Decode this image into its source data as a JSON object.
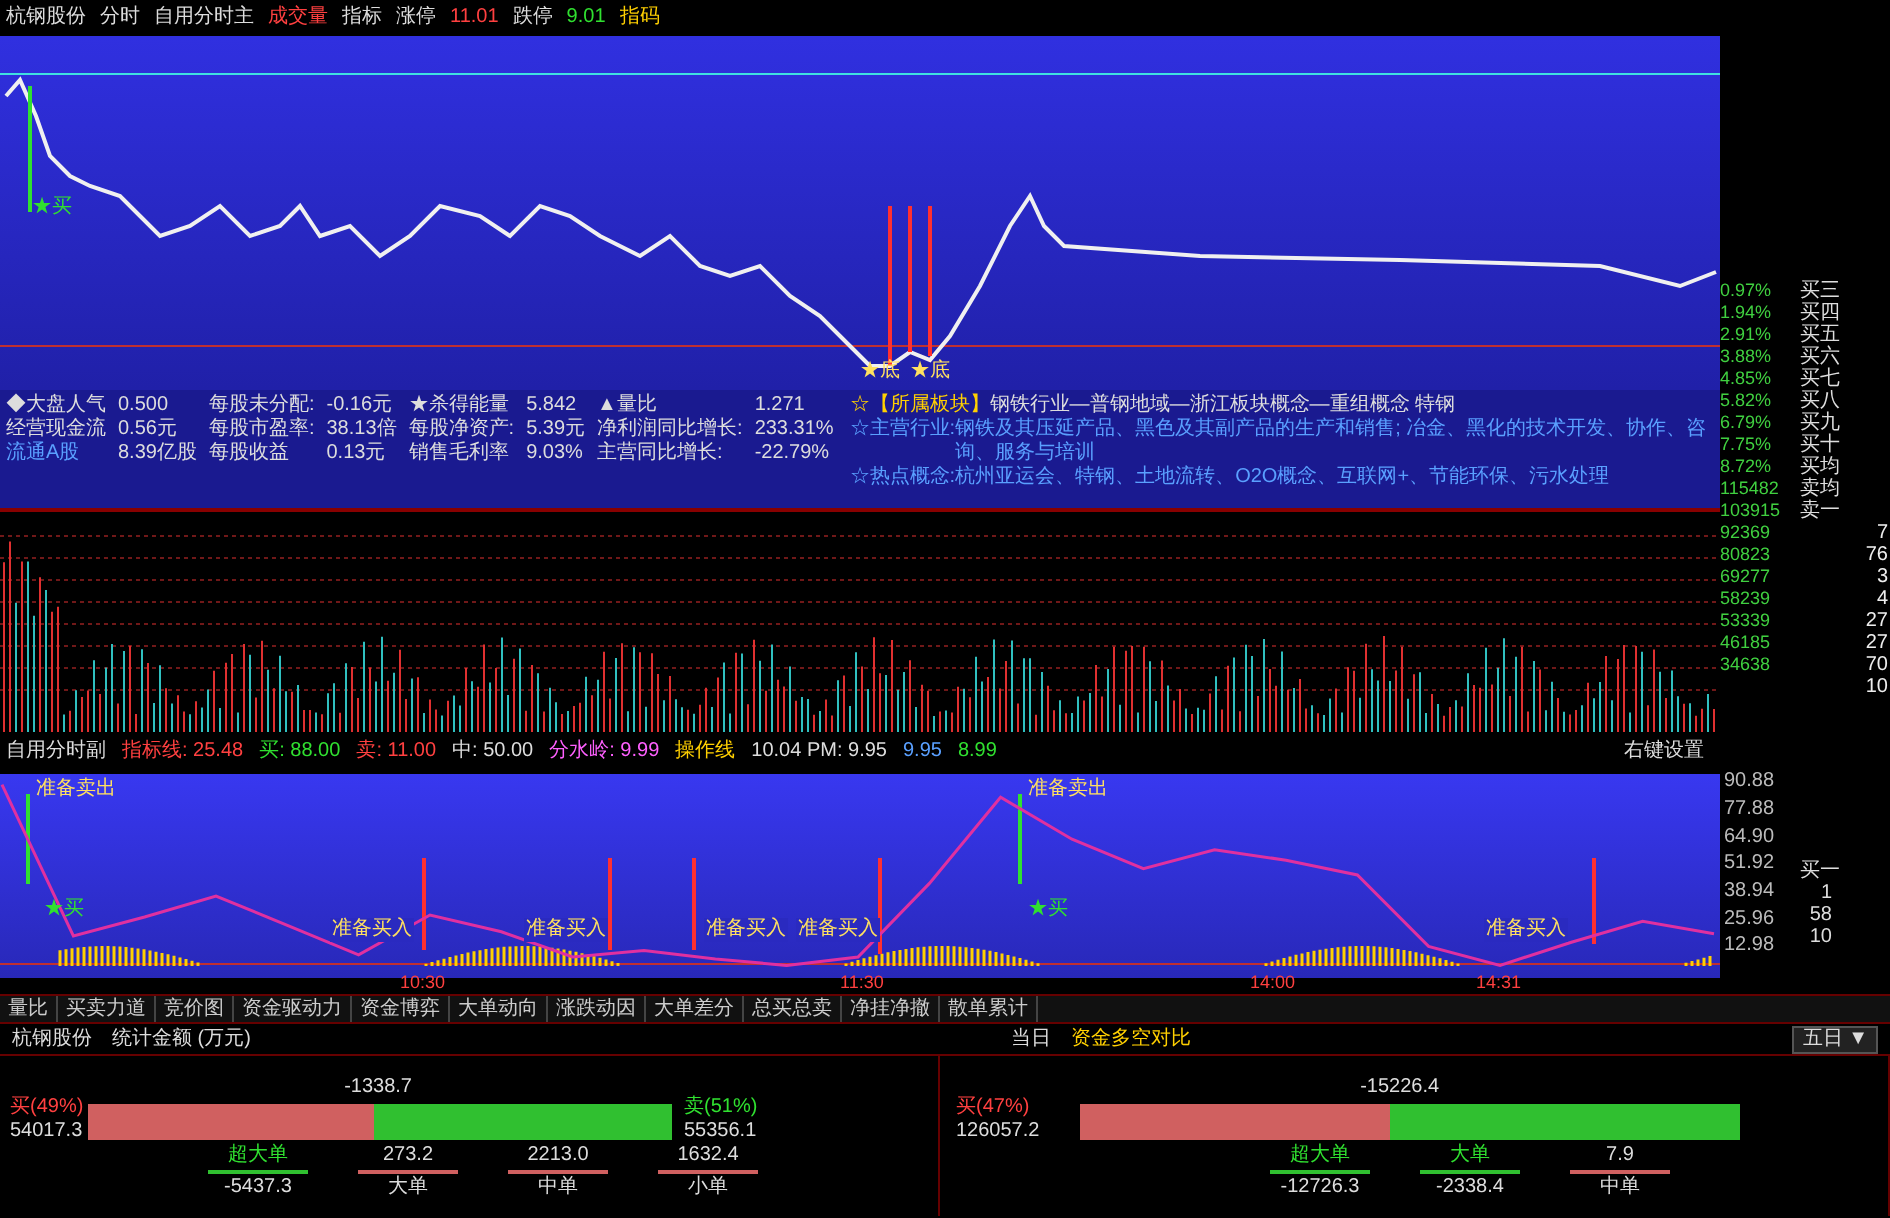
{
  "top_bar": [
    {
      "text": "杭钢股份",
      "color": "#dddddd"
    },
    {
      "text": "分时",
      "color": "#dddddd"
    },
    {
      "text": "自用分时主",
      "color": "#dddddd"
    },
    {
      "text": "成交量",
      "color": "#ff4040"
    },
    {
      "text": "指标",
      "color": "#dddddd"
    },
    {
      "text": "涨停",
      "color": "#dddddd"
    },
    {
      "text": "11.01",
      "color": "#ff4040"
    },
    {
      "text": "跌停",
      "color": "#dddddd"
    },
    {
      "text": "9.01",
      "color": "#30e030"
    },
    {
      "text": "指码",
      "color": "#ffd000"
    }
  ],
  "price_chart": {
    "markers": [
      {
        "text": "★买",
        "kind": "buy"
      },
      {
        "text": "★底",
        "kind": "bottom"
      },
      {
        "text": "★底",
        "kind": "bottom"
      }
    ]
  },
  "info_stats": [
    [
      {
        "label": "◆大盘人气",
        "value": "0.500"
      },
      {
        "label": "每股未分配:",
        "value": "-0.16元"
      },
      {
        "label": "★杀得能量",
        "value": "5.842"
      },
      {
        "label": "▲量比",
        "value": "1.271"
      }
    ],
    [
      {
        "label": "经营现金流",
        "value": "0.56元"
      },
      {
        "label": "每股市盈率:",
        "value": "38.13倍"
      },
      {
        "label": "每股净资产:",
        "value": "5.39元"
      },
      {
        "label": "净利润同比增长:",
        "value": "233.31%"
      }
    ],
    [
      {
        "label": "流通A股",
        "value": "8.39亿股"
      },
      {
        "label": "每股收益",
        "value": "0.13元"
      },
      {
        "label": "销售毛利率",
        "value": "9.03%"
      },
      {
        "label": "主营同比增长:",
        "value": "-22.79%"
      }
    ]
  ],
  "info_notes": [
    {
      "label": "☆【所属板块】",
      "text": "钢铁行业—普钢地域—浙江板块概念—重组概念 特钢"
    },
    {
      "label": "☆主营行业:",
      "text": "钢铁及其压延产品、黑色及其副产品的生产和销售; 冶金、黑化的技术开发、协作、咨询、服务与培训"
    },
    {
      "label": "☆热点概念:",
      "text": "杭州亚运会、特钢、土地流转、O2O概念、互联网+、节能环保、污水处理"
    }
  ],
  "side_rows": [
    {
      "axis": "0.97%",
      "label": "买三"
    },
    {
      "axis": "1.94%",
      "label": "买四"
    },
    {
      "axis": "2.91%",
      "label": "买五"
    },
    {
      "axis": "3.88%",
      "label": "买六"
    },
    {
      "axis": "4.85%",
      "label": "买七"
    },
    {
      "axis": "5.82%",
      "label": "买八"
    },
    {
      "axis": "6.79%",
      "label": "买九"
    },
    {
      "axis": "7.75%",
      "label": "买十"
    },
    {
      "axis": "8.72%",
      "label": "买均"
    },
    {
      "axis": "115482",
      "label": "卖均"
    },
    {
      "axis": "103915",
      "label": "卖一"
    },
    {
      "axis": "92369",
      "count": "7"
    },
    {
      "axis": "80823",
      "count": "76"
    },
    {
      "axis": "69277",
      "count": "3"
    },
    {
      "axis": "58239",
      "count": "4"
    },
    {
      "axis": "53339",
      "count": "27"
    },
    {
      "axis": "46185",
      "count": "27"
    },
    {
      "axis": "34638",
      "count": "70"
    },
    {
      "count": "10"
    }
  ],
  "indicator_header": [
    {
      "text": "自用分时副",
      "color": "#dddddd"
    },
    {
      "text": "指标线: 25.48",
      "color": "#ff4040"
    },
    {
      "text": "买: 88.00",
      "color": "#30e030"
    },
    {
      "text": "卖: 11.00",
      "color": "#ff4040"
    },
    {
      "text": "中: 50.00",
      "color": "#dddddd"
    },
    {
      "text": "分水岭: 9.99",
      "color": "#ff60ff"
    },
    {
      "text": "操作线",
      "color": "#ffd000"
    },
    {
      "text": "10.04 PM: 9.95",
      "color": "#dddddd"
    },
    {
      "text": "9.95",
      "color": "#5aa0ff"
    },
    {
      "text": "8.99",
      "color": "#30e030"
    }
  ],
  "indicator_settings": "右键设置",
  "indicator_chart": {
    "markers": [
      {
        "text": "准备卖出",
        "kind": "sell"
      },
      {
        "text": "准备卖出",
        "kind": "sell"
      },
      {
        "text": "★买",
        "kind": "buy"
      },
      {
        "text": "★买",
        "kind": "buy"
      },
      {
        "text": "准备买入",
        "kind": "prepare"
      },
      {
        "text": "准备买入",
        "kind": "prepare"
      },
      {
        "text": "准备买入",
        "kind": "prepare"
      },
      {
        "text": "准备买入",
        "kind": "prepare"
      },
      {
        "text": "准备买入",
        "kind": "prepare"
      }
    ],
    "chart_data": {
      "type": "line",
      "categories": [
        null,
        null,
        null,
        null,
        null,
        null,
        null,
        null,
        null,
        null,
        null,
        null,
        null,
        null,
        null,
        null,
        null,
        null,
        null,
        null,
        null,
        null,
        null,
        null,
        null
      ],
      "series": [
        {
          "color": "#e030a0",
          "values": [
            90,
            18,
            27,
            37,
            23,
            9,
            28,
            20,
            8,
            11,
            7,
            4,
            8,
            43,
            84,
            64,
            50,
            59,
            54,
            47,
            13,
            4,
            15,
            25,
            19
          ]
        }
      ],
      "ylim": [
        -2,
        95
      ],
      "yticks": [
        {
          "value": 90.88,
          "label": "90.88"
        },
        {
          "value": 77.88,
          "label": "77.88"
        },
        {
          "value": 64.9,
          "label": "64.90"
        },
        {
          "value": 51.92,
          "label": "51.92"
        },
        {
          "value": 38.94,
          "label": "38.94"
        },
        {
          "value": 25.96,
          "label": "25.96"
        },
        {
          "value": 12.98,
          "label": "12.98"
        }
      ]
    },
    "times": [
      "10:30",
      "11:30",
      "14:00",
      "14:31"
    ]
  },
  "bid": {
    "label": "买一",
    "counts": [
      "1",
      "58",
      "10"
    ]
  },
  "tabs": [
    {
      "label": "量比",
      "selected": false
    },
    {
      "label": "买卖力道",
      "selected": false
    },
    {
      "label": "竞价图",
      "selected": false
    },
    {
      "label": "资金驱动力",
      "selected": false
    },
    {
      "label": "资金博弈",
      "selected": false
    },
    {
      "label": "大单动向",
      "selected": false
    },
    {
      "label": "涨跌动因",
      "selected": false
    },
    {
      "label": "大单差分",
      "selected": false
    },
    {
      "label": "总买总卖",
      "selected": false
    },
    {
      "label": "净挂净撤",
      "selected": false
    },
    {
      "label": "散单累计",
      "selected": false
    }
  ],
  "panel_header": {
    "stock": "杭钢股份",
    "unit": "统计金额 (万元)",
    "day": "当日",
    "title": "资金多空对比",
    "period": "五日 ▼"
  },
  "flow_panels": [
    {
      "buy_label": "买(49%)",
      "buy_value": "54017.3",
      "net": "-1338.7",
      "level": 0.49,
      "sell_label": "卖(51%)",
      "sell_value": "55356.1",
      "orders": [
        {
          "name": "超大单",
          "value": "-5437.3",
          "name_above": true
        },
        {
          "name": "大单",
          "value": "273.2",
          "name_above": false
        },
        {
          "name": "中单",
          "value": "2213.0",
          "name_above": false
        },
        {
          "name": "小单",
          "value": "1632.4",
          "name_above": false
        }
      ]
    },
    {
      "buy_label": "买(47%)",
      "buy_value": "126057.2",
      "net": "-15226.4",
      "level": 0.47,
      "orders": [
        {
          "name": "超大单",
          "value": "-12726.3",
          "name_above": true
        },
        {
          "name": "大单",
          "value": "-2338.4",
          "name_above": true
        },
        {
          "name": "中单",
          "value": "7.9",
          "name_above": false
        }
      ]
    }
  ]
}
